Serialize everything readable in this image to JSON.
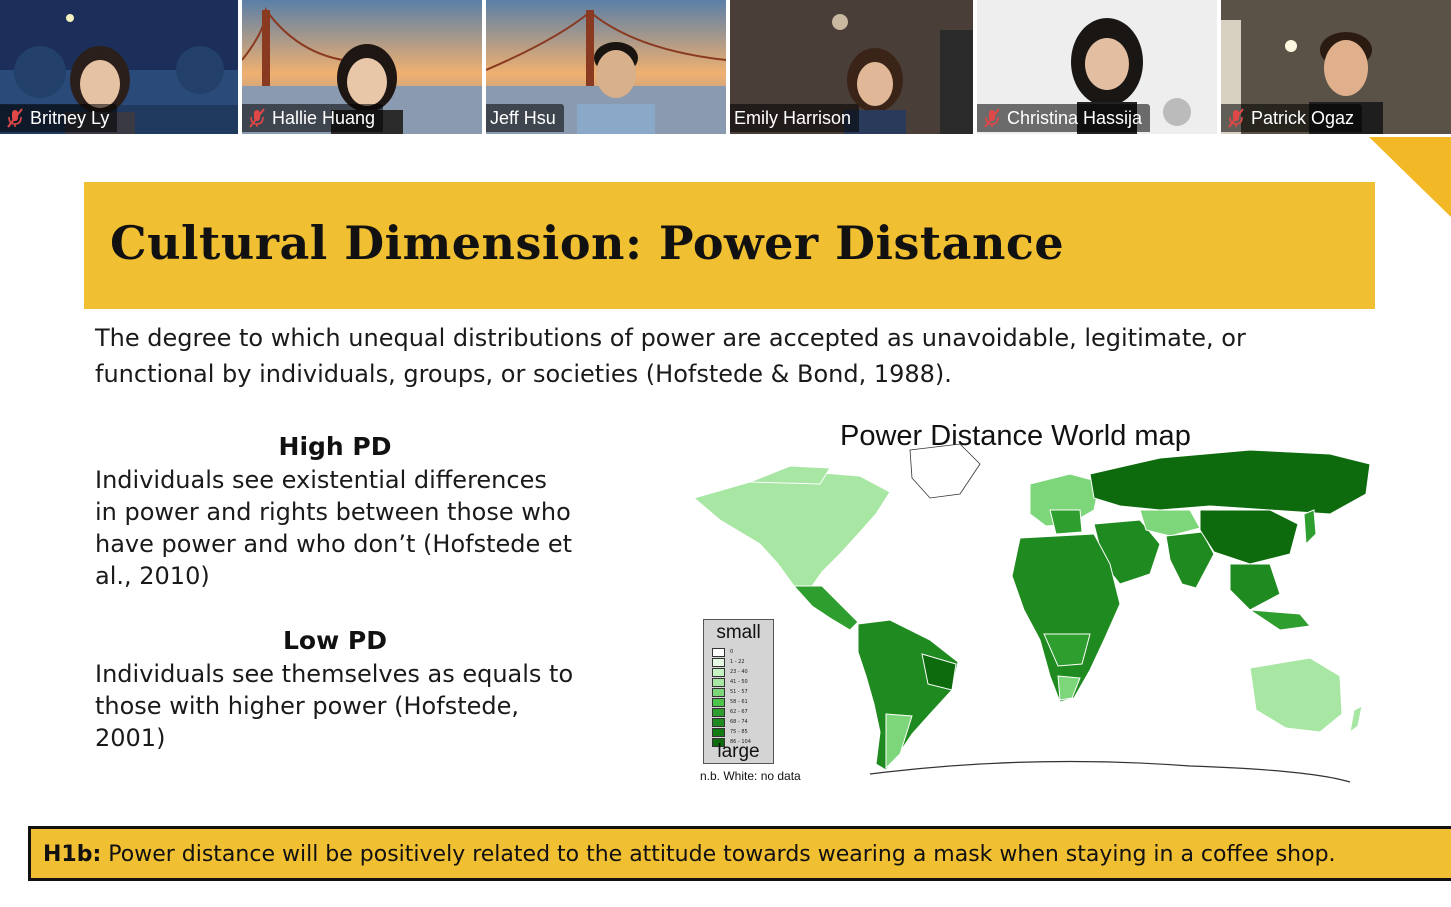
{
  "participants": [
    {
      "name": "Britney Ly",
      "muted": true,
      "active": false
    },
    {
      "name": "Hallie Huang",
      "muted": true,
      "active": false
    },
    {
      "name": "Jeff Hsu",
      "muted": false,
      "active": false
    },
    {
      "name": "Emily Harrison",
      "muted": false,
      "active": true
    },
    {
      "name": "Christina Hassija",
      "muted": true,
      "active": false
    },
    {
      "name": "Patrick Ogaz",
      "muted": true,
      "active": false
    }
  ],
  "slide": {
    "title": "Cultural Dimension: Power Distance",
    "definition": "The degree to which unequal distributions of power are accepted as unavoidable, legitimate, or functional by individuals, groups, or societies (Hofstede & Bond, 1988).",
    "high_pd": {
      "heading": "High PD",
      "body": "Individuals see existential differences in power and rights between those who have power and who don’t (Hofstede et al., 2010)"
    },
    "low_pd": {
      "heading": "Low PD",
      "body": "Individuals see themselves as equals to those with higher power (Hofstede, 2001)"
    },
    "map": {
      "title": "Power Distance World map",
      "legend_top": "small",
      "legend_bottom": "large",
      "legend_ranges": [
        "0",
        "1 - 22",
        "23 - 40",
        "41 - 50",
        "51 - 57",
        "58 - 61",
        "62 - 67",
        "68 - 74",
        "75 - 85",
        "86 - 104"
      ],
      "note": "n.b. White: no data"
    },
    "hypothesis": {
      "label": "H1b:",
      "text": " Power distance will be positively related to the attitude towards wearing a mask when staying in a coffee shop."
    }
  },
  "colors": {
    "accent_yellow": "#f1bf32",
    "map_light": "#a8e6a3",
    "map_mid": "#2e9e2e",
    "map_dark": "#0d6b0d",
    "active_speaker": "#9acd32"
  }
}
